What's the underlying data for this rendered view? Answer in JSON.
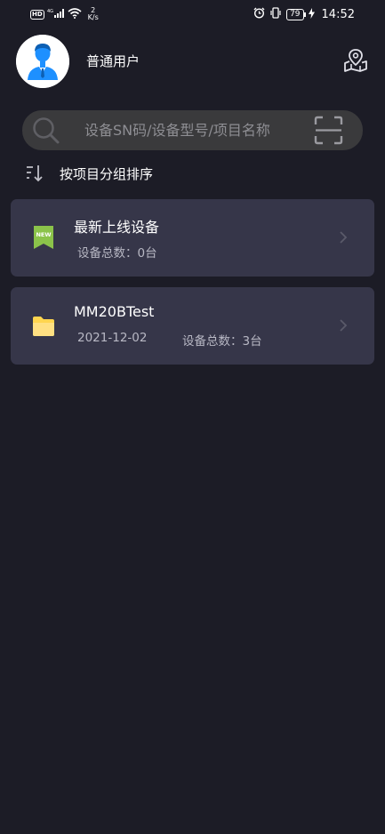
{
  "status_bar": {
    "hd": "HD",
    "network_type": "4G",
    "speed_value": "2",
    "speed_unit": "K/s",
    "battery": "79",
    "time": "14:52"
  },
  "header": {
    "username": "普通用户"
  },
  "search": {
    "placeholder": "设备SN码/设备型号/项目名称"
  },
  "sort": {
    "label": "按项目分组排序"
  },
  "groups": [
    {
      "title": "最新上线设备",
      "device_count": "设备总数：0台",
      "icon": "new-badge-icon",
      "badge_text": "NEW"
    },
    {
      "title": "MM20BTest",
      "date": "2021-12-02",
      "device_count": "设备总数：3台",
      "icon": "folder-icon"
    }
  ],
  "colors": {
    "background": "#1c1c26",
    "card": "#363649",
    "search_bar": "#3a3a3c",
    "avatar_accent": "#1e90ff",
    "new_badge": "#8bc34a",
    "folder": "#ffd54f"
  }
}
